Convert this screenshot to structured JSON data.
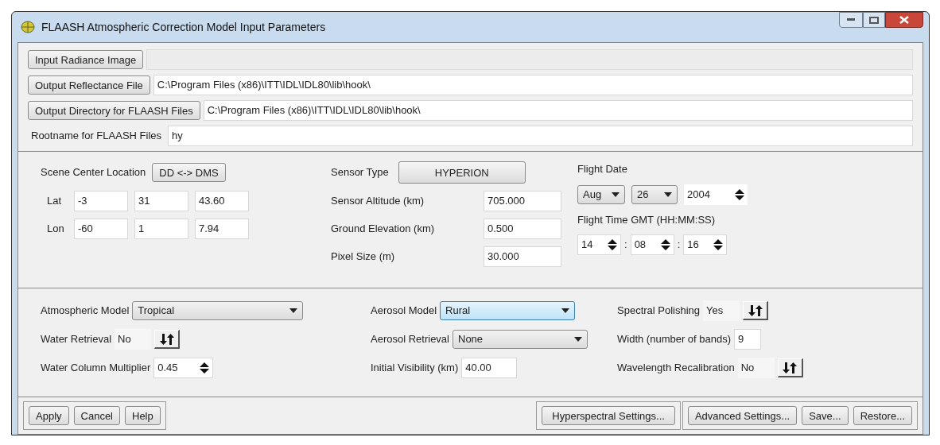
{
  "window": {
    "title": "FLAASH Atmospheric Correction Model Input Parameters"
  },
  "file_rows": [
    {
      "kind": "button",
      "label": "Input Radiance Image",
      "disabled": true
    },
    {
      "kind": "button",
      "label": "Output Reflectance File",
      "value": "C:\\Program Files (x86)\\ITT\\IDL\\IDL80\\lib\\hook\\",
      "disabled": false
    },
    {
      "kind": "button",
      "label": "Output Directory for FLAASH Files",
      "value": "C:\\Program Files (x86)\\ITT\\IDL\\IDL80\\lib\\hook\\",
      "disabled": false
    },
    {
      "kind": "label",
      "label": "Rootname for FLAASH Files",
      "value": "hy",
      "disabled": false
    }
  ],
  "scene": {
    "label": "Scene Center Location",
    "toggle": "DD <-> DMS",
    "coords": [
      {
        "label": "Lat",
        "values": [
          "-3",
          "31",
          "43.60"
        ]
      },
      {
        "label": "Lon",
        "values": [
          "-60",
          "1",
          "7.94"
        ]
      }
    ]
  },
  "sensor": {
    "type_label": "Sensor Type",
    "type_button": "HYPERION",
    "fields": [
      {
        "label": "Sensor Altitude (km)",
        "value": "705.000"
      },
      {
        "label": "Ground Elevation (km)",
        "value": "0.500"
      },
      {
        "label": "Pixel Size (m)",
        "value": "30.000"
      }
    ]
  },
  "flight": {
    "date_label": "Flight Date",
    "month": "Aug",
    "day": "26",
    "year": "2004",
    "time_label": "Flight Time GMT (HH:MM:SS)",
    "time": [
      "14",
      "08",
      "16"
    ],
    "separators": [
      ":",
      ":"
    ]
  },
  "options": [
    [
      {
        "kind": "select",
        "label": "Atmospheric Model",
        "value": "Tropical",
        "focused": false
      },
      {
        "kind": "toggle",
        "label": "Water Retrieval",
        "value": "No"
      },
      {
        "kind": "spinner",
        "label": "Water Column Multiplier",
        "value": "0.45"
      }
    ],
    [
      {
        "kind": "select",
        "label": "Aerosol Model",
        "value": "Rural",
        "focused": true
      },
      {
        "kind": "select",
        "label": "Aerosol Retrieval",
        "value": "None",
        "focused": false
      },
      {
        "kind": "text",
        "label": "Initial Visibility (km)",
        "value": "40.00"
      }
    ],
    [
      {
        "kind": "toggle",
        "label": "Spectral Polishing",
        "value": "Yes"
      },
      {
        "kind": "text",
        "label": "Width (number of bands)",
        "value": "9"
      },
      {
        "kind": "toggle",
        "label": "Wavelength Recalibration",
        "value": "No"
      }
    ]
  ],
  "button_groups": [
    [
      "Apply",
      "Cancel",
      "Help"
    ],
    [
      "Hyperspectral Settings..."
    ],
    [
      "Advanced Settings...",
      "Save...",
      "Restore..."
    ]
  ]
}
